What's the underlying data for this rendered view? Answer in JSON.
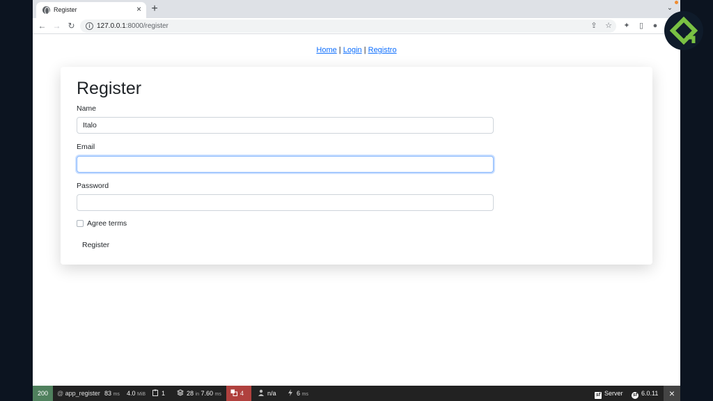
{
  "browser": {
    "tab_title": "Register",
    "url_host": "127.0.0.1",
    "url_rest": ":8000/register"
  },
  "nav": {
    "home": "Home",
    "login": "Login",
    "registro": "Registro",
    "separator": " | "
  },
  "form": {
    "title": "Register",
    "name_label": "Name",
    "name_value": "Italo",
    "email_label": "Email",
    "email_value": "",
    "password_label": "Password",
    "password_value": "",
    "agree_label": "Agree terms",
    "agree_checked": false,
    "submit_label": "Register"
  },
  "debug_toolbar": {
    "status": "200",
    "route": "app_register",
    "time_value": "83",
    "time_unit": "ms",
    "memory_value": "4.0",
    "memory_unit": "MiB",
    "forms": "1",
    "db_queries": "28",
    "db_in": "in",
    "db_time": "7.60",
    "db_unit": "ms",
    "translations": "4",
    "user": "n/a",
    "events_value": "6",
    "events_unit": "ms",
    "server": "Server",
    "version": "6.0.11"
  },
  "colors": {
    "status_ok": "#4f805d",
    "translations_error": "#b0413e",
    "link": "#0d6efd",
    "brand_green": "#7ac143"
  }
}
